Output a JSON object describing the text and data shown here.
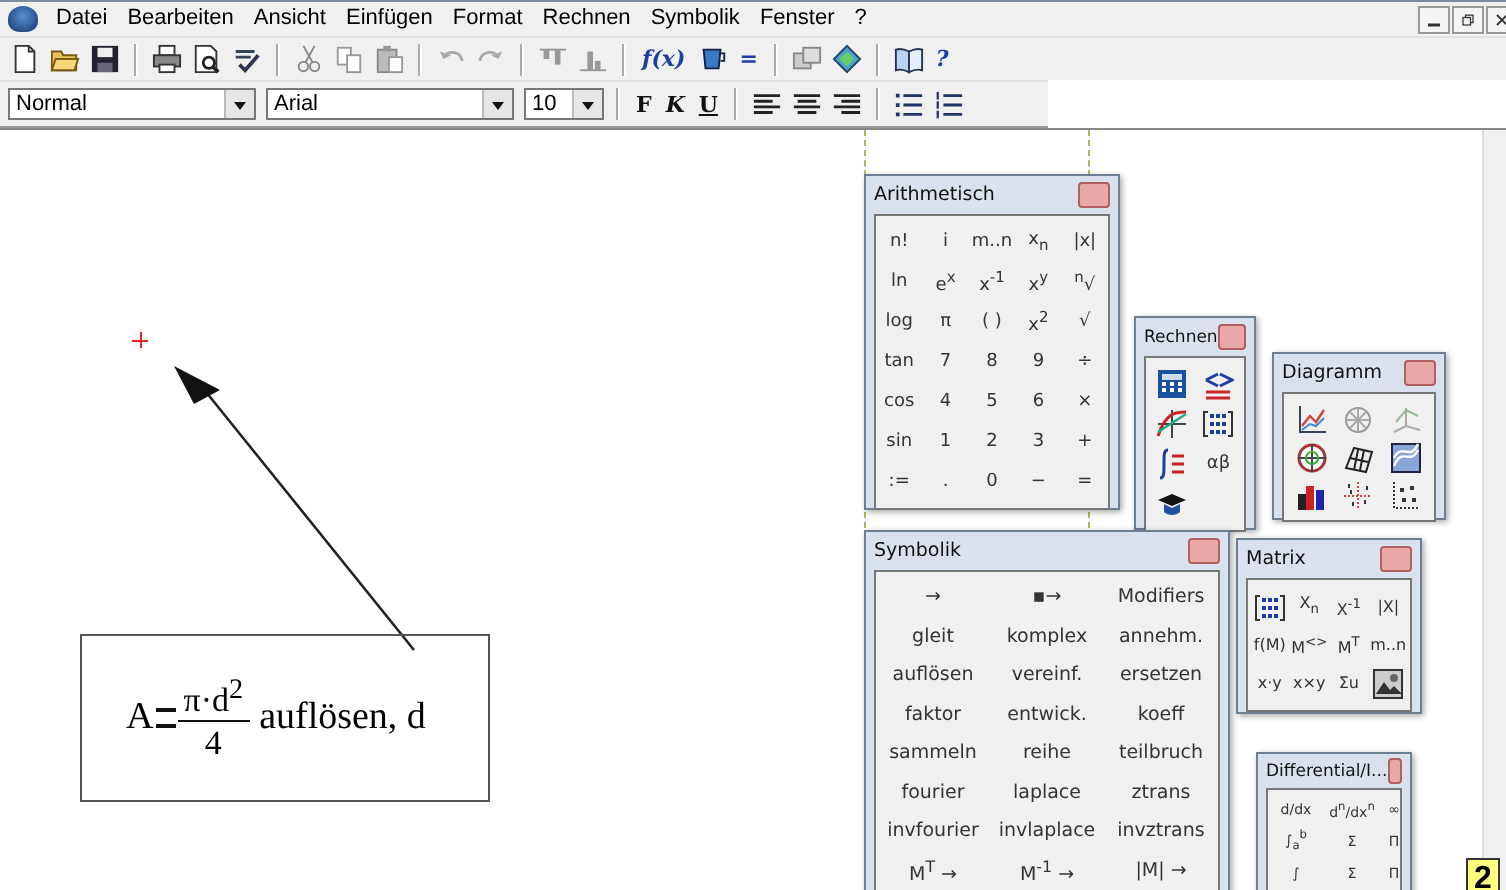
{
  "menu": [
    "Datei",
    "Bearbeiten",
    "Ansicht",
    "Einfügen",
    "Format",
    "Rechnen",
    "Symbolik",
    "Fenster",
    "?"
  ],
  "toolbar": [
    {
      "kind": "new"
    },
    {
      "kind": "open"
    },
    {
      "kind": "save"
    },
    {
      "kind": "sep"
    },
    {
      "kind": "print"
    },
    {
      "kind": "preview"
    },
    {
      "kind": "spell"
    },
    {
      "kind": "sep"
    },
    {
      "kind": "cut"
    },
    {
      "kind": "copy"
    },
    {
      "kind": "paste"
    },
    {
      "kind": "sep"
    },
    {
      "kind": "undo"
    },
    {
      "kind": "redo"
    },
    {
      "kind": "sep"
    },
    {
      "kind": "aligntop"
    },
    {
      "kind": "alignbottom"
    },
    {
      "kind": "sep"
    },
    {
      "kind": "text",
      "label": "f(x)"
    },
    {
      "kind": "unit"
    },
    {
      "kind": "text",
      "label": "="
    },
    {
      "kind": "sep"
    },
    {
      "kind": "component"
    },
    {
      "kind": "resource"
    },
    {
      "kind": "sep"
    },
    {
      "kind": "book"
    },
    {
      "kind": "text",
      "label": "?"
    }
  ],
  "format_bar": {
    "style": "Normal",
    "font": "Arial",
    "size": "10",
    "buttons": [
      {
        "kind": "bold",
        "label": "F"
      },
      {
        "kind": "italic",
        "label": "K"
      },
      {
        "kind": "underline",
        "label": "U"
      },
      {
        "kind": "sep"
      },
      {
        "kind": "alignleft"
      },
      {
        "kind": "aligncenter"
      },
      {
        "kind": "alignright"
      },
      {
        "kind": "sep"
      },
      {
        "kind": "bullets"
      },
      {
        "kind": "numbers"
      }
    ]
  },
  "worksheet": {
    "region": {
      "lhs": "A",
      "numerator": "π·d$^{2}$",
      "denominator": "4",
      "command": "auflösen, d"
    },
    "corner_label": "2"
  },
  "palettes": [
    {
      "kind": "arithmetic",
      "title": "Arithmetisch",
      "buttons": [
        {
          "kind": "text",
          "label": "n!"
        },
        {
          "kind": "text",
          "label": "i"
        },
        {
          "kind": "text",
          "label": "m..n"
        },
        {
          "kind": "text",
          "label": "x$_{n}$"
        },
        {
          "kind": "text",
          "label": "|x|"
        },
        {
          "kind": "text",
          "label": "ln"
        },
        {
          "kind": "text",
          "label": "e$^{x}$"
        },
        {
          "kind": "text",
          "label": "x$^{-1}$"
        },
        {
          "kind": "text",
          "label": "x$^{y}$"
        },
        {
          "kind": "text",
          "label": "$^{n}$√"
        },
        {
          "kind": "text",
          "label": "log"
        },
        {
          "kind": "text",
          "label": "π"
        },
        {
          "kind": "text",
          "label": "( )"
        },
        {
          "kind": "text",
          "label": "x$^{2}$"
        },
        {
          "kind": "text",
          "label": "√"
        },
        {
          "kind": "text",
          "label": "tan"
        },
        {
          "kind": "text",
          "label": "7"
        },
        {
          "kind": "text",
          "label": "8"
        },
        {
          "kind": "text",
          "label": "9"
        },
        {
          "kind": "text",
          "label": "÷"
        },
        {
          "kind": "text",
          "label": "cos"
        },
        {
          "kind": "text",
          "label": "4"
        },
        {
          "kind": "text",
          "label": "5"
        },
        {
          "kind": "text",
          "label": "6"
        },
        {
          "kind": "text",
          "label": "×"
        },
        {
          "kind": "text",
          "label": "sin"
        },
        {
          "kind": "text",
          "label": "1"
        },
        {
          "kind": "text",
          "label": "2"
        },
        {
          "kind": "text",
          "label": "3"
        },
        {
          "kind": "text",
          "label": "+"
        },
        {
          "kind": "text",
          "label": ":="
        },
        {
          "kind": "text",
          "label": "."
        },
        {
          "kind": "text",
          "label": "0"
        },
        {
          "kind": "text",
          "label": "−"
        },
        {
          "kind": "text",
          "label": "="
        }
      ]
    },
    {
      "kind": "calculus",
      "title": "Rechnen",
      "buttons": [
        {
          "kind": "calculator"
        },
        {
          "kind": "inequality"
        },
        {
          "kind": "graph"
        },
        {
          "kind": "matrix"
        },
        {
          "kind": "integral"
        },
        {
          "kind": "text",
          "label": "αβ"
        },
        {
          "kind": "cap"
        }
      ]
    },
    {
      "kind": "graph",
      "title": "Diagramm",
      "buttons": [
        {
          "kind": "xyplot"
        },
        {
          "kind": "polar"
        },
        {
          "kind": "surface3d"
        },
        {
          "kind": "target"
        },
        {
          "kind": "mesh"
        },
        {
          "kind": "contour"
        },
        {
          "kind": "bars"
        },
        {
          "kind": "scatter"
        },
        {
          "kind": "dots"
        }
      ]
    },
    {
      "kind": "symbolic",
      "title": "Symbolik",
      "buttons": [
        {
          "kind": "text",
          "label": "→"
        },
        {
          "kind": "text",
          "label": "▪→"
        },
        {
          "kind": "text",
          "label": "Modifiers"
        },
        {
          "kind": "text",
          "label": "gleit"
        },
        {
          "kind": "text",
          "label": "komplex"
        },
        {
          "kind": "text",
          "label": "annehm."
        },
        {
          "kind": "text",
          "label": "auflösen"
        },
        {
          "kind": "text",
          "label": "vereinf."
        },
        {
          "kind": "text",
          "label": "ersetzen"
        },
        {
          "kind": "text",
          "label": "faktor"
        },
        {
          "kind": "text",
          "label": "entwick."
        },
        {
          "kind": "text",
          "label": "koeff"
        },
        {
          "kind": "text",
          "label": "sammeln"
        },
        {
          "kind": "text",
          "label": "reihe"
        },
        {
          "kind": "text",
          "label": "teilbruch"
        },
        {
          "kind": "text",
          "label": "fourier"
        },
        {
          "kind": "text",
          "label": "laplace"
        },
        {
          "kind": "text",
          "label": "ztrans"
        },
        {
          "kind": "text",
          "label": "invfourier"
        },
        {
          "kind": "text",
          "label": "invlaplace"
        },
        {
          "kind": "text",
          "label": "invztrans"
        },
        {
          "kind": "text",
          "label": "M$^{T}$ →"
        },
        {
          "kind": "text",
          "label": "M$^{-1}$ →"
        },
        {
          "kind": "text",
          "label": "|M| →"
        }
      ]
    },
    {
      "kind": "matrix",
      "title": "Matrix",
      "buttons": [
        {
          "kind": "matrix"
        },
        {
          "kind": "text",
          "label": "X$_{n}$"
        },
        {
          "kind": "text",
          "label": "X$^{-1}$"
        },
        {
          "kind": "text",
          "label": "|X|"
        },
        {
          "kind": "text",
          "label": "f(M)"
        },
        {
          "kind": "text",
          "label": "M$^{<>}$"
        },
        {
          "kind": "text",
          "label": "M$^{T}$"
        },
        {
          "kind": "text",
          "label": "m..n"
        },
        {
          "kind": "text",
          "label": "x·y"
        },
        {
          "kind": "text",
          "label": "x×y"
        },
        {
          "kind": "text",
          "label": "Σu"
        },
        {
          "kind": "picturebtn"
        }
      ]
    },
    {
      "kind": "differential",
      "title": "Differential/I...",
      "buttons": [
        {
          "kind": "text",
          "label": "d/dx"
        },
        {
          "kind": "text",
          "label": "d$^{n}$/dx$^{n}$"
        },
        {
          "kind": "text",
          "label": "∞"
        },
        {
          "kind": "text",
          "label": "∫$_{a}$$^{b}$"
        },
        {
          "kind": "text",
          "label": "Σ"
        },
        {
          "kind": "text",
          "label": "Π"
        },
        {
          "kind": "text",
          "label": "∫"
        },
        {
          "kind": "text",
          "label": "Σ"
        },
        {
          "kind": "text",
          "label": "Π"
        }
      ]
    }
  ]
}
